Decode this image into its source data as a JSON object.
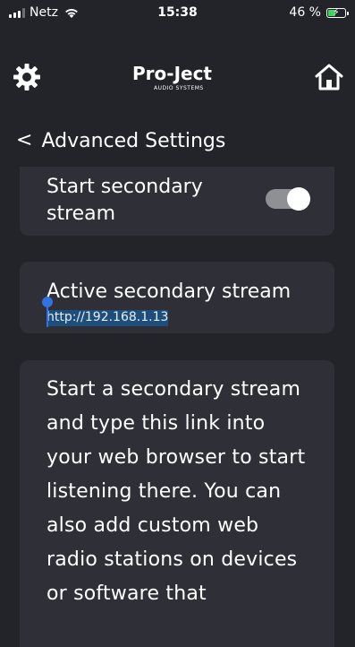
{
  "status_bar": {
    "carrier": "Netz",
    "time": "15:38",
    "battery": "46 %",
    "battery_level": 0.46
  },
  "header": {
    "settings_icon": "gear-icon",
    "home_icon": "home-icon",
    "logo": {
      "main": "Pro-Ject",
      "sub": "AUDIO SYSTEMS"
    }
  },
  "nav": {
    "back_icon": "chevron-left-icon",
    "title": "Advanced Settings"
  },
  "secondary_stream": {
    "label": "Start secondary stream",
    "enabled": true
  },
  "active_stream": {
    "label": "Active secondary stream",
    "url": "http://192.168.1.13"
  },
  "info": {
    "text": "Start a secondary stream and type this link into your web browser to start listening there. You can also add custom web radio stations on devices or software that"
  },
  "colors": {
    "background": "#23242a",
    "card": "#2e2f37",
    "selection": "#1e4f7c",
    "handle": "#2f72e0",
    "battery": "#3fd55a"
  }
}
